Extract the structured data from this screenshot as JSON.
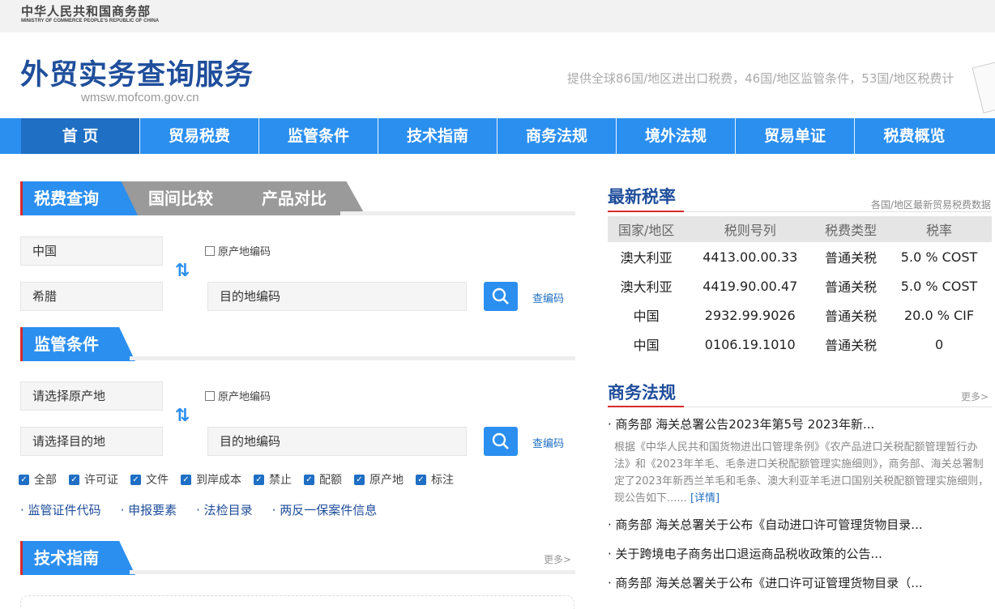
{
  "ministry": {
    "name_cn": "中华人民共和国商务部",
    "name_en": "MINISTRY OF COMMERCE PEOPLE'S REPUBLIC OF CHINA"
  },
  "site": {
    "title": "外贸实务查询服务",
    "url": "wmsw.mofcom.gov.cn",
    "slogan": "提供全球86国/地区进出口税费，46国/地区监管条件，53国/地区税费计"
  },
  "nav": [
    "首 页",
    "贸易税费",
    "监管条件",
    "技术指南",
    "商务法规",
    "境外法规",
    "贸易单证",
    "税费概览"
  ],
  "tax_query": {
    "tabs": [
      "税费查询",
      "国间比较",
      "产品对比"
    ],
    "origin_value": "中国",
    "destination_value": "希腊",
    "origin_code_label": "原产地编码",
    "dest_code_placeholder": "目的地编码",
    "code_link": "查编码"
  },
  "supervision": {
    "heading": "监管条件",
    "origin_placeholder": "请选择原产地",
    "destination_placeholder": "请选择目的地",
    "origin_code_label": "原产地编码",
    "dest_code_placeholder": "目的地编码",
    "code_link": "查编码",
    "filters": [
      "全部",
      "许可证",
      "文件",
      "到岸成本",
      "禁止",
      "配额",
      "原产地",
      "标注"
    ],
    "links": [
      "监管证件代码",
      "申报要素",
      "法检目录",
      "两反一保案件信息"
    ]
  },
  "tech_guide": {
    "heading": "技术指南",
    "more": "更多>"
  },
  "latest_rates": {
    "heading": "最新税率",
    "subtitle": "各国/地区最新贸易税费数据",
    "columns": [
      "国家/地区",
      "税则号列",
      "税费类型",
      "税率"
    ],
    "rows": [
      [
        "澳大利亚",
        "4413.00.00.33",
        "普通关税",
        "5.0 % COST"
      ],
      [
        "澳大利亚",
        "4419.90.00.47",
        "普通关税",
        "5.0 % COST"
      ],
      [
        "中国",
        "2932.99.9026",
        "普通关税",
        "20.0 % CIF"
      ],
      [
        "中国",
        "0106.19.1010",
        "普通关税",
        "0"
      ]
    ]
  },
  "regulations": {
    "heading": "商务法规",
    "more": "更多>",
    "items": [
      "· 商务部 海关总署公告2023年第5号 2023年新...",
      "· 商务部 海关总署关于公布《自动进口许可管理货物目录...",
      "· 关于跨境电子商务出口退运商品税收政策的公告...",
      "· 商务部 海关总署关于公布《进口许可证管理货物目录（..."
    ],
    "first_desc": "根据《中华人民共和国货物进出口管理条例》《农产品进口关税配额管理暂行办法》和《2023年羊毛、毛条进口关税配额管理实施细则》，商务部、海关总署制定了2023年新西兰羊毛和毛条、澳大利亚羊毛进口国别关税配额管理实施细则，现公告如下......",
    "detail": "[详情]"
  }
}
